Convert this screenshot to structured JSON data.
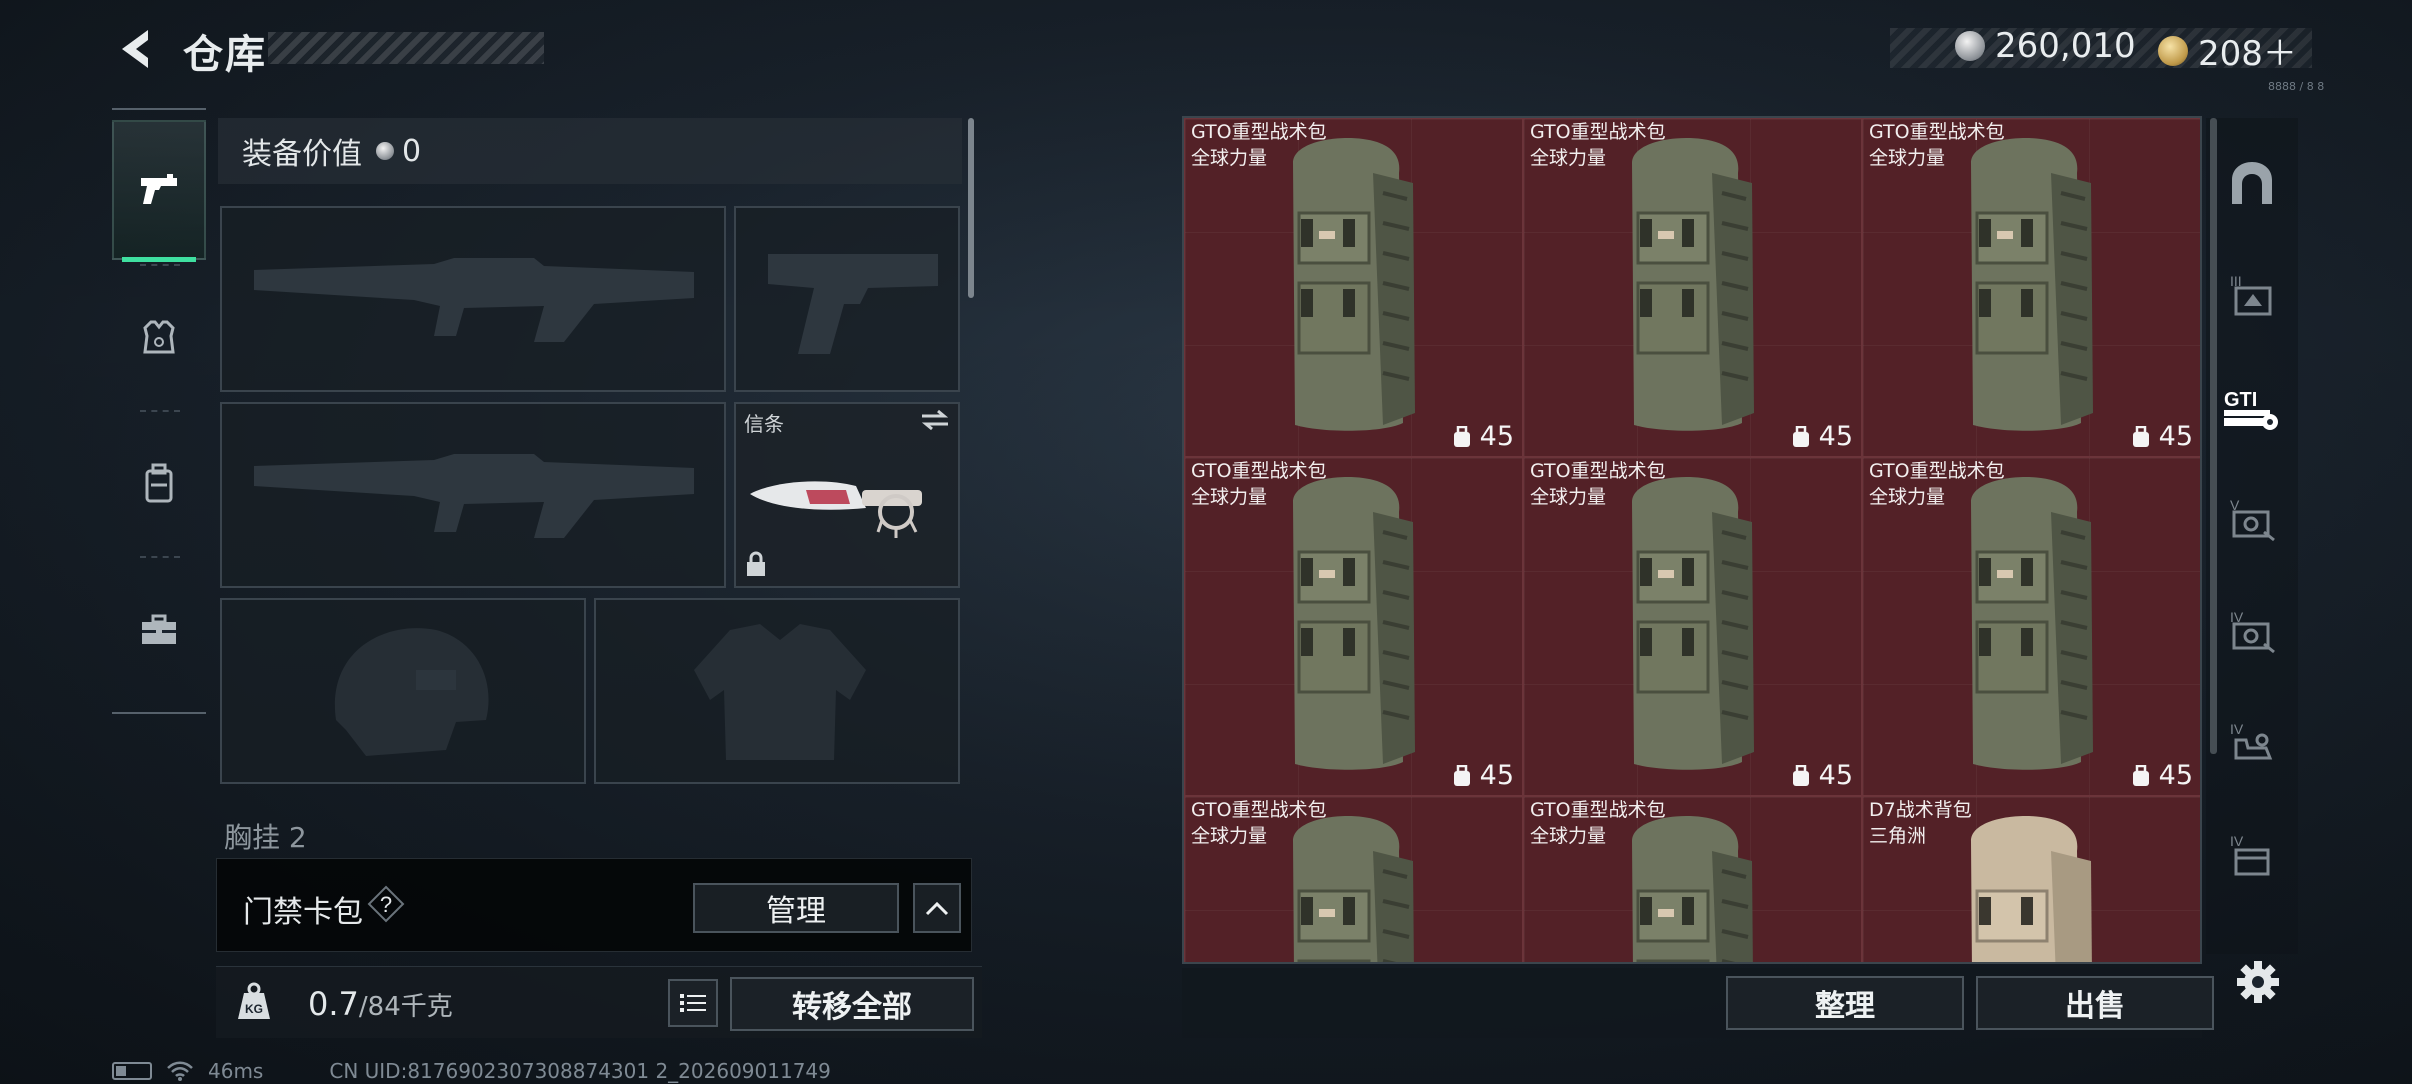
{
  "header": {
    "title": "仓库",
    "currency": [
      {
        "icon": "silver-coin-icon",
        "value": "260,010"
      },
      {
        "icon": "gold-coin-icon",
        "value": "208＋"
      }
    ],
    "corner_code": "8888 / 8 8"
  },
  "left_nav": {
    "items": [
      {
        "icon": "pistol-icon",
        "active": true
      },
      {
        "icon": "armor-vest-icon",
        "active": false
      },
      {
        "icon": "backpack-icon",
        "active": false
      },
      {
        "icon": "toolbox-icon",
        "active": false
      }
    ]
  },
  "equipment": {
    "value_label": "装备价值",
    "value": "0",
    "slots": [
      {
        "id": "primary-1",
        "label": ""
      },
      {
        "id": "sidearm",
        "label": ""
      },
      {
        "id": "primary-2",
        "label": ""
      },
      {
        "id": "melee",
        "label": "信条"
      },
      {
        "id": "helmet",
        "label": ""
      },
      {
        "id": "armor",
        "label": ""
      }
    ],
    "partial_label": "胸挂 2",
    "keycard": {
      "label": "门禁卡包",
      "help": "?",
      "manage": "管理"
    },
    "weight": {
      "current": "0.7",
      "max": "/84千克"
    },
    "transfer_all": "转移全部"
  },
  "storage": {
    "items": [
      {
        "name": "GTO重型战术包",
        "sub": "全球力量",
        "durability": "45",
        "color": "green"
      },
      {
        "name": "GTO重型战术包",
        "sub": "全球力量",
        "durability": "45",
        "color": "green"
      },
      {
        "name": "GTO重型战术包",
        "sub": "全球力量",
        "durability": "45",
        "color": "green"
      },
      {
        "name": "GTO重型战术包",
        "sub": "全球力量",
        "durability": "45",
        "color": "green"
      },
      {
        "name": "GTO重型战术包",
        "sub": "全球力量",
        "durability": "45",
        "color": "green"
      },
      {
        "name": "GTO重型战术包",
        "sub": "全球力量",
        "durability": "45",
        "color": "green"
      },
      {
        "name": "GTO重型战术包",
        "sub": "全球力量",
        "durability": "",
        "color": "green"
      },
      {
        "name": "GTO重型战术包",
        "sub": "全球力量",
        "durability": "",
        "color": "green"
      },
      {
        "name": "D7战术背包",
        "sub": "三角洲",
        "durability": "",
        "color": "tan"
      }
    ],
    "sort": "整理",
    "sell": "出售"
  },
  "right_nav": {
    "items": [
      {
        "icon": "arch-icon",
        "active": false
      },
      {
        "icon": "tier-iii-box-icon",
        "active": false
      },
      {
        "icon": "gti-badge-icon",
        "active": true
      },
      {
        "icon": "tier-v-camera-icon",
        "active": false
      },
      {
        "icon": "tier-iv-camera-icon",
        "active": false
      },
      {
        "icon": "tier-iv-hand-icon",
        "active": false
      },
      {
        "icon": "tier-iv-box-icon",
        "active": false
      }
    ],
    "settings_icon": "gear-icon"
  },
  "status": {
    "ping": "46ms",
    "uid": "CN UID:8176902307308874301 2_202609011749"
  },
  "colors": {
    "accent": "#3fe0a0",
    "storage_cell": "#532127"
  }
}
